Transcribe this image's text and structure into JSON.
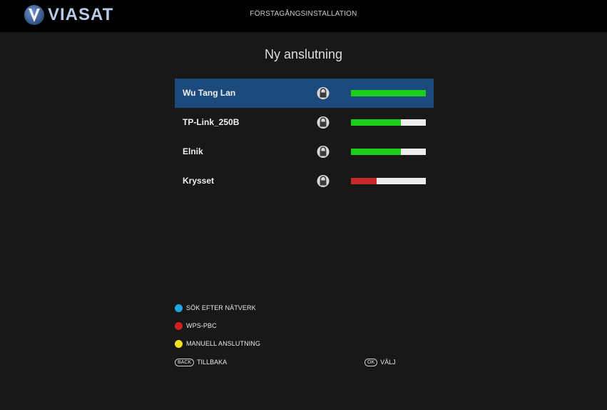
{
  "header": {
    "brand": "VIASAT",
    "screen_title": "FÖRSTAGÅNGSINSTALLATION"
  },
  "page": {
    "title": "Ny anslutning"
  },
  "networks": [
    {
      "name": "Wu Tang Lan",
      "secured": true,
      "signal": 1.0,
      "signal_color": "#19cf19",
      "selected": true
    },
    {
      "name": "TP-Link_250B",
      "secured": true,
      "signal": 0.67,
      "signal_color": "#19cf19",
      "selected": false
    },
    {
      "name": "Elnik",
      "secured": true,
      "signal": 0.67,
      "signal_color": "#19cf19",
      "selected": false
    },
    {
      "name": "Krysset",
      "secured": true,
      "signal": 0.34,
      "signal_color": "#c42a2a",
      "selected": false
    }
  ],
  "legend": [
    {
      "color": "#1ea7e0",
      "label": "SÖK EFTER NÄTVERK",
      "icon": "blue-key-icon"
    },
    {
      "color": "#d02020",
      "label": "WPS-PBC",
      "icon": "red-key-icon"
    },
    {
      "color": "#f0e020",
      "label": "MANUELL ANSLUTNING",
      "icon": "yellow-key-icon"
    }
  ],
  "hints": {
    "back_key": "BACK",
    "back_label": "TILLBAKA",
    "ok_key": "OK",
    "ok_label": "VÄLJ"
  },
  "colors": {
    "background": "#181818",
    "topbar": "#000000",
    "selection": "#1c4a7d",
    "signal_empty": "#ececec"
  }
}
